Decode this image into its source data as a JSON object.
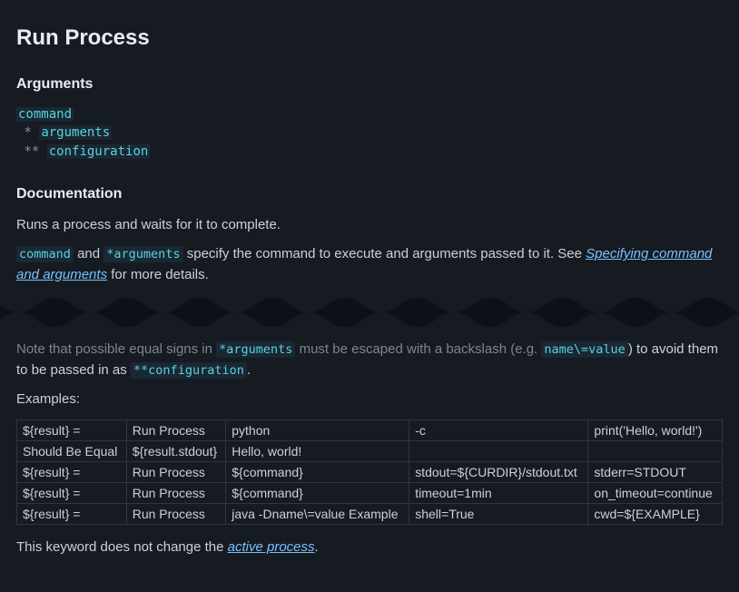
{
  "title": "Run Process",
  "sections": {
    "arguments_heading": "Arguments",
    "documentation_heading": "Documentation"
  },
  "arguments": {
    "command": "command",
    "arguments_prefix": "*",
    "arguments": "arguments",
    "configuration_prefix": "**",
    "configuration": "configuration"
  },
  "doc": {
    "intro": "Runs a process and waits for it to complete.",
    "p2_code1": "command",
    "p2_mid1": " and ",
    "p2_code2": "*arguments",
    "p2_mid2": " specify the command to execute and arguments passed to it. See ",
    "p2_link": "Specifying command and arguments",
    "p2_tail": " for more details.",
    "p3_lead": "Note that possible equal signs in ",
    "p3_code1": "*arguments",
    "p3_mid1": " must be escaped with a backslash (e.g. ",
    "p3_code2": "name\\=value",
    "p3_mid2": ") to avoid them to be passed in as ",
    "p3_code3": "**configuration",
    "p3_tail": ".",
    "examples_label": "Examples:",
    "closing_lead": "This keyword does not change the ",
    "closing_link": "active process",
    "closing_tail": "."
  },
  "chart_data": {
    "type": "table",
    "rows": [
      [
        "${result} =",
        "Run Process",
        "python",
        "-c",
        "print('Hello, world!')"
      ],
      [
        "Should Be Equal",
        "${result.stdout}",
        "Hello, world!",
        "",
        ""
      ],
      [
        "${result} =",
        "Run Process",
        "${command}",
        "stdout=${CURDIR}/stdout.txt",
        "stderr=STDOUT"
      ],
      [
        "${result} =",
        "Run Process",
        "${command}",
        "timeout=1min",
        "on_timeout=continue"
      ],
      [
        "${result} =",
        "Run Process",
        "java -Dname\\=value Example",
        "shell=True",
        "cwd=${EXAMPLE}"
      ]
    ]
  }
}
